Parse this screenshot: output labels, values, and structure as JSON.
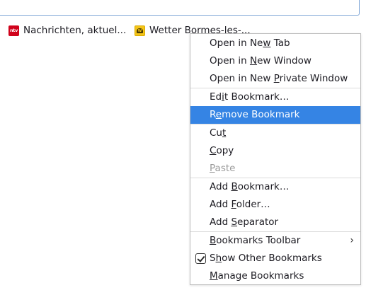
{
  "bookmarks_toolbar": {
    "items": [
      {
        "label": "Nachrichten, aktuel...",
        "icon": "ntv-favicon-icon",
        "favicon_text": "ntv"
      },
      {
        "label": "Wetter Bormes-les-...",
        "icon": "wetter-favicon-icon",
        "favicon_text": "W"
      }
    ]
  },
  "context_menu": {
    "open_new_tab": {
      "pre": "Open in Ne",
      "key": "w",
      "post": " Tab"
    },
    "open_new_window": {
      "pre": "Open in ",
      "key": "N",
      "post": "ew Window"
    },
    "open_private_window": {
      "pre": "Open in New ",
      "key": "P",
      "post": "rivate Window"
    },
    "edit_bookmark": {
      "pre": "Ed",
      "key": "i",
      "post": "t Bookmark…"
    },
    "remove_bookmark": {
      "pre": "R",
      "key": "e",
      "post": "move Bookmark"
    },
    "cut": {
      "pre": "Cu",
      "key": "t",
      "post": ""
    },
    "copy": {
      "pre": "",
      "key": "C",
      "post": "opy"
    },
    "paste": {
      "pre": "",
      "key": "P",
      "post": "aste"
    },
    "add_bookmark": {
      "pre": "Add ",
      "key": "B",
      "post": "ookmark…"
    },
    "add_folder": {
      "pre": "Add ",
      "key": "F",
      "post": "older…"
    },
    "add_separator": {
      "pre": "Add ",
      "key": "S",
      "post": "eparator"
    },
    "bookmarks_toolbar": {
      "pre": "",
      "key": "B",
      "post": "ookmarks Toolbar",
      "arrow": "›"
    },
    "show_other_bookmarks": {
      "pre": "S",
      "key": "h",
      "post": "ow Other Bookmarks",
      "checked": true
    },
    "manage_bookmarks": {
      "pre": "",
      "key": "M",
      "post": "anage Bookmarks"
    }
  },
  "colors": {
    "highlight": "#3584e4",
    "disabled_text": "#9a9a9a",
    "ntv_red": "#d0021b",
    "wetter_yellow": "#f5c518"
  }
}
